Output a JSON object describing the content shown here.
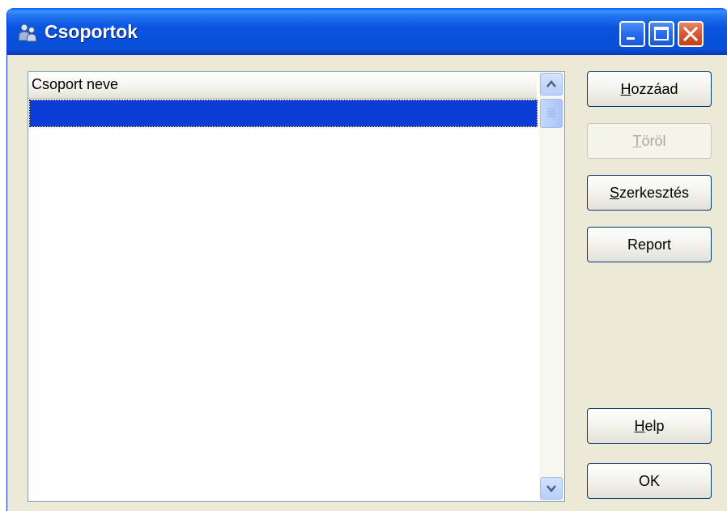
{
  "window": {
    "title": "Csoportok",
    "icon": "users-icon"
  },
  "list": {
    "column_header": "Csoport neve",
    "rows": [
      ""
    ],
    "selected_index": 0
  },
  "buttons": {
    "add": {
      "pre": "",
      "key": "H",
      "post": "ozzáad",
      "enabled": true
    },
    "delete": {
      "pre": "",
      "key": "T",
      "post": "öröl",
      "enabled": false
    },
    "edit": {
      "pre": "",
      "key": "S",
      "post": "zerkesztés",
      "enabled": true
    },
    "report": {
      "label": "Report",
      "enabled": true
    },
    "help": {
      "pre": "",
      "key": "H",
      "post": "elp",
      "enabled": true
    },
    "ok": {
      "label": "OK",
      "enabled": true
    }
  },
  "colors": {
    "titlebar": "#0a55e0",
    "selection": "#0a3cd8",
    "face": "#ece9d8"
  }
}
